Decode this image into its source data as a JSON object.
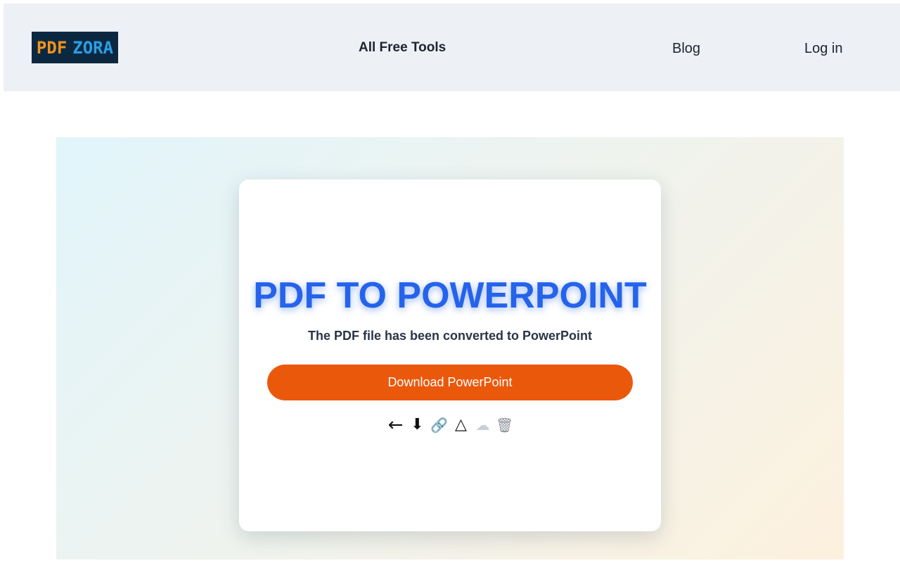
{
  "header": {
    "logo": {
      "part1": "PDF",
      "part2": "ZORA",
      "colors": {
        "background": "#0c2840",
        "part1": "#f2931b",
        "part2": "#2a9fe8"
      }
    },
    "nav": {
      "all_tools": "All Free Tools",
      "blog": "Blog",
      "login": "Log in"
    }
  },
  "card": {
    "title": "PDF TO POWERPOINT",
    "subtitle": "The PDF file has been converted to PowerPoint",
    "download_label": "Download PowerPoint",
    "actions": [
      {
        "name": "back-arrow-icon",
        "glyph": "←"
      },
      {
        "name": "download-icon",
        "glyph": "⬇"
      },
      {
        "name": "link-icon",
        "glyph": "🔗"
      },
      {
        "name": "google-drive-icon",
        "glyph": "△"
      },
      {
        "name": "cloud-icon",
        "glyph": "☁"
      },
      {
        "name": "trash-icon",
        "glyph": "🗑"
      }
    ]
  },
  "colors": {
    "title": "#2563eb",
    "button": "#ea580c",
    "header_bg": "#edf0f5"
  }
}
